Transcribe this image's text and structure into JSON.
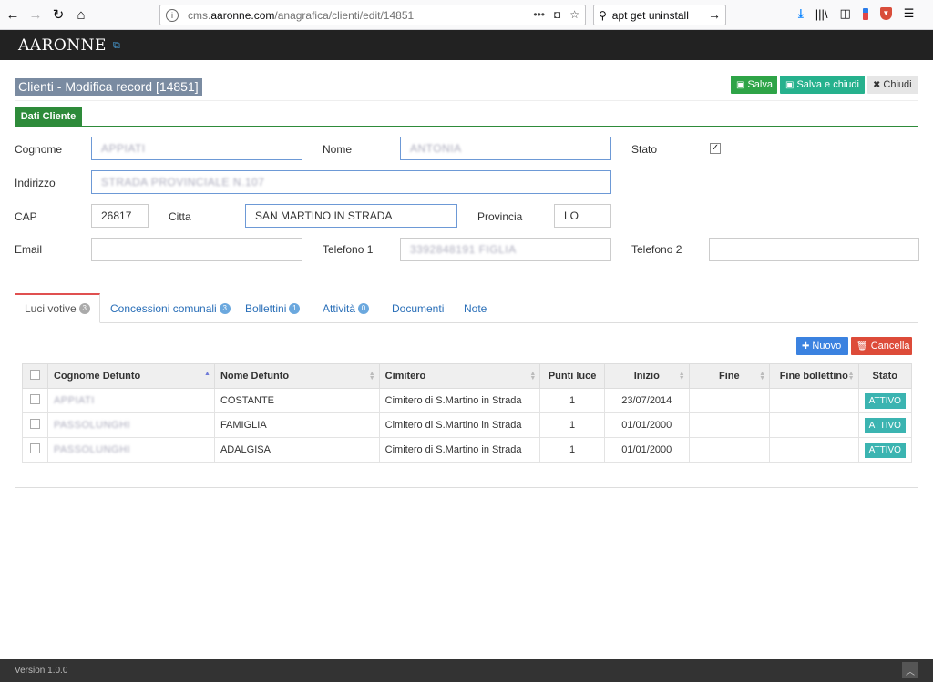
{
  "browser": {
    "url_prefix": "cms.",
    "url_host": "aaronne.com",
    "url_path": "/anagrafica/clienti/edit/14851",
    "search_text": "apt get uninstall"
  },
  "app": {
    "logo_text": "AARONNE"
  },
  "page": {
    "title": "Clienti - Modifica record [14851]",
    "buttons": {
      "salva": "Salva",
      "salva_chiudi": "Salva e chiudi",
      "chiudi": "Chiudi"
    },
    "form_tab": "Dati Cliente"
  },
  "form": {
    "cognome_label": "Cognome",
    "cognome_value": "APPIATI",
    "nome_label": "Nome",
    "nome_value": "ANTONIA",
    "stato_label": "Stato",
    "stato_checked": true,
    "indirizzo_label": "Indirizzo",
    "indirizzo_value": "STRADA PROVINCIALE N.107",
    "cap_label": "CAP",
    "cap_value": "26817",
    "citta_label": "Citta",
    "citta_value": "SAN MARTINO IN STRADA",
    "provincia_label": "Provincia",
    "provincia_value": "LO",
    "email_label": "Email",
    "email_value": "",
    "telefono1_label": "Telefono 1",
    "telefono1_value": "3392848191 FIGLIA",
    "telefono2_label": "Telefono 2",
    "telefono2_value": ""
  },
  "tabs": [
    {
      "label": "Luci votive",
      "badge": "3"
    },
    {
      "label": "Concessioni comunali",
      "badge": "3"
    },
    {
      "label": "Bollettini",
      "badge": "1"
    },
    {
      "label": "Attività",
      "badge": "0"
    },
    {
      "label": "Documenti",
      "badge": ""
    },
    {
      "label": "Note",
      "badge": ""
    }
  ],
  "table": {
    "buttons": {
      "nuovo": "Nuovo",
      "cancella": "Cancella"
    },
    "headers": [
      "Cognome Defunto",
      "Nome Defunto",
      "Cimitero",
      "Punti luce",
      "Inizio",
      "Fine",
      "Fine bollettino",
      "Stato"
    ],
    "rows": [
      [
        "APPIATI",
        "COSTANTE",
        "Cimitero di S.Martino in Strada",
        "1",
        "23/07/2014",
        "",
        "",
        "ATTIVO"
      ],
      [
        "PASSOLUNGHI",
        "FAMIGLIA",
        "Cimitero di S.Martino in Strada",
        "1",
        "01/01/2000",
        "",
        "",
        "ATTIVO"
      ],
      [
        "PASSOLUNGHI",
        "ADALGISA",
        "Cimitero di S.Martino in Strada",
        "1",
        "01/01/2000",
        "",
        "",
        "ATTIVO"
      ]
    ]
  },
  "footer": {
    "version": "Version 1.0.0"
  },
  "colors": {
    "primary_green": "#2ea447",
    "teal": "#26b18d",
    "status_teal": "#3bb4b1",
    "blue": "#3b82e0",
    "red": "#dd4b39",
    "title_bg": "#7a8ba1"
  }
}
